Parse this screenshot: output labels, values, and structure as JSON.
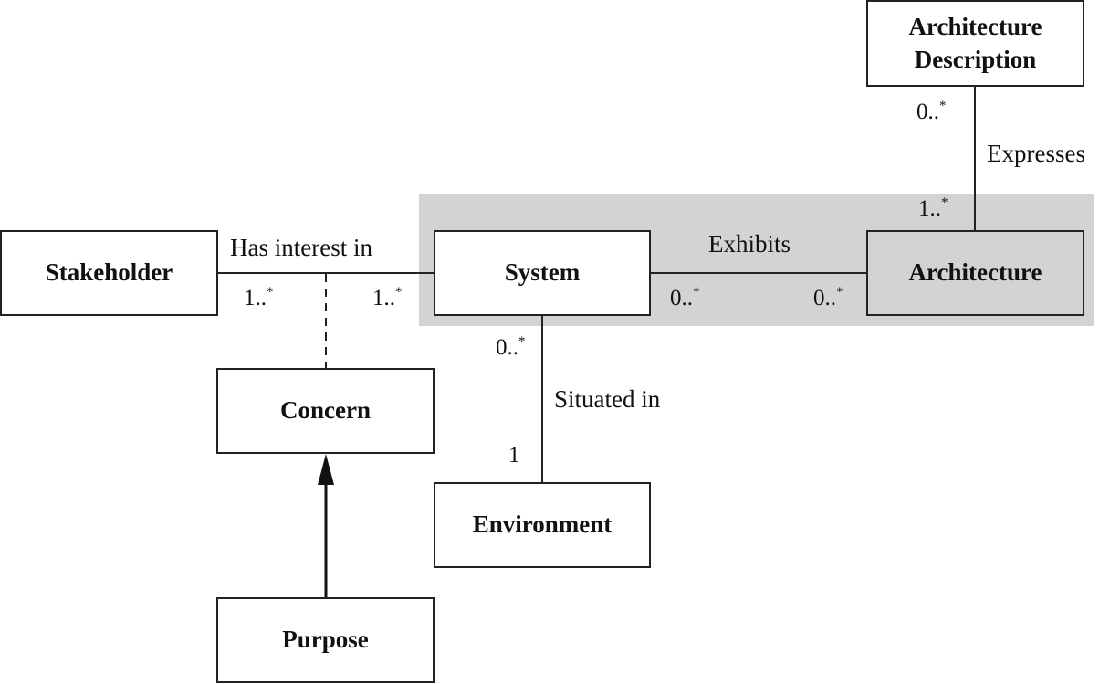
{
  "diagram": {
    "type": "UML class diagram",
    "highlight_region": "system-architecture",
    "classes": {
      "architecture_description": "Architecture\nDescription",
      "stakeholder": "Stakeholder",
      "system": "System",
      "architecture": "Architecture",
      "concern": "Concern",
      "environment": "Environment",
      "purpose": "Purpose"
    },
    "associations": {
      "has_interest_in": {
        "label": "Has interest in",
        "from": "Stakeholder",
        "to": "System",
        "from_mult": "1..",
        "to_mult": "1..",
        "star": "*"
      },
      "exhibits": {
        "label": "Exhibits",
        "from": "System",
        "to": "Architecture",
        "from_mult": "0..",
        "to_mult": "0..",
        "star": "*"
      },
      "expresses": {
        "label": "Expresses",
        "from": "Architecture Description",
        "to": "Architecture",
        "from_mult": "0..",
        "to_mult": "1..",
        "star": "*"
      },
      "situated_in": {
        "label": "Situated in",
        "from": "System",
        "to": "Environment",
        "from_mult": "0..",
        "to_mult": "1",
        "star": "*"
      }
    },
    "association_class_link": {
      "from": "Has interest in",
      "to": "Concern",
      "style": "dashed"
    },
    "generalization": {
      "from": "Purpose",
      "to": "Concern",
      "arrow": "filled"
    },
    "colors": {
      "line": "#222222",
      "highlight": "#d3d3d5",
      "box_fill": "#ffffff"
    }
  }
}
